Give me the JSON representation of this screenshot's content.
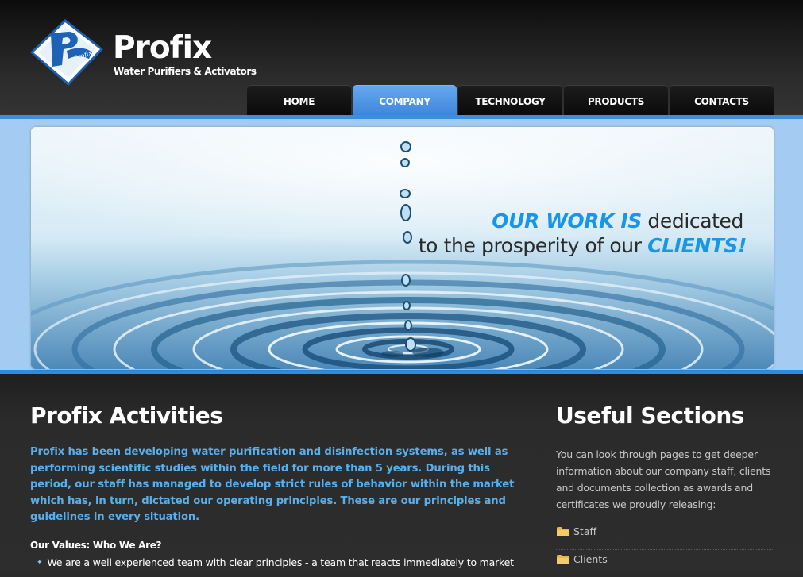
{
  "brand": {
    "logo_text": "Profix",
    "name": "Profix",
    "tagline": "Water Purifiers & Activators"
  },
  "nav": {
    "items": [
      {
        "label": "HOME",
        "active": false
      },
      {
        "label": "COMPANY",
        "active": true
      },
      {
        "label": "TECHNOLOGY",
        "active": false
      },
      {
        "label": "PRODUCTS",
        "active": false
      },
      {
        "label": "CONTACTS",
        "active": false
      }
    ]
  },
  "banner": {
    "line1_highlight": "OUR WORK IS",
    "line1_rest": " dedicated",
    "line2_text": "to the prosperity of our ",
    "line2_highlight": "CLIENTS!"
  },
  "activities": {
    "title": "Profix Activities",
    "intro": "Profix has been developing water purification and disinfection systems, as well as performing scientific studies within the field for more than 5 years. During this period, our staff has managed to develop strict rules of behavior within the market which has, in turn, dictated our operating principles. These are our principles and guidelines in every situation.",
    "values_heading": "Our Values: Who We Are?",
    "values": [
      "We are a well experienced team with clear principles - a team that reacts immediately to market"
    ]
  },
  "useful": {
    "title": "Useful Sections",
    "text": "You can look through pages to get deeper information about our company staff, clients and documents collection as awards and certificates we proudly releasing:",
    "links": [
      {
        "label": "Staff",
        "icon": "folder-icon"
      },
      {
        "label": "Clients",
        "icon": "folder-icon"
      }
    ]
  },
  "colors": {
    "accent_blue": "#1a96e6",
    "nav_active": "#4a90e2",
    "intro_text": "#5aaeea",
    "banner_band": "#a4ccf2",
    "background": "#2b2b2b"
  }
}
